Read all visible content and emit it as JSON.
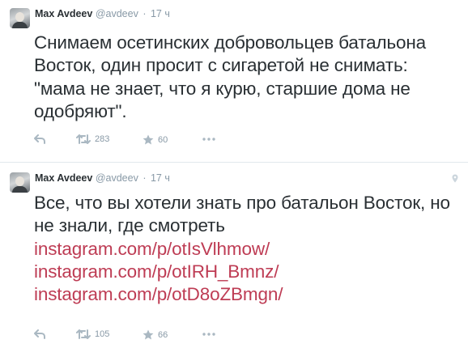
{
  "tweets": [
    {
      "name": "Max Avdeev",
      "handle": "@avdeev",
      "separator": "·",
      "time": "17 ч",
      "text": "Снимаем осетинских добровольцев батальона Восток, один просит с сигаретой не снимать: \"мама не знает, что я курю, старшие дома не одобряют\".",
      "links": [],
      "retweets": "283",
      "favorites": "60"
    },
    {
      "name": "Max Avdeev",
      "handle": "@avdeev",
      "separator": "·",
      "time": "17 ч",
      "text": "Все, что вы хотели знать про батальон Восток, но не знали, где смотреть",
      "links": [
        "instagram.com/p/otIsVlhmow/",
        "instagram.com/p/otIRH_Bmnz/",
        "instagram.com/p/otD8oZBmgn/"
      ],
      "retweets": "105",
      "favorites": "66"
    }
  ],
  "colors": {
    "link": "#be3c54",
    "muted": "#8899a6",
    "icon": "#aab8c2"
  },
  "icons": [
    "reply-icon",
    "retweet-icon",
    "favorite-icon",
    "more-icon",
    "location-pin-icon"
  ]
}
